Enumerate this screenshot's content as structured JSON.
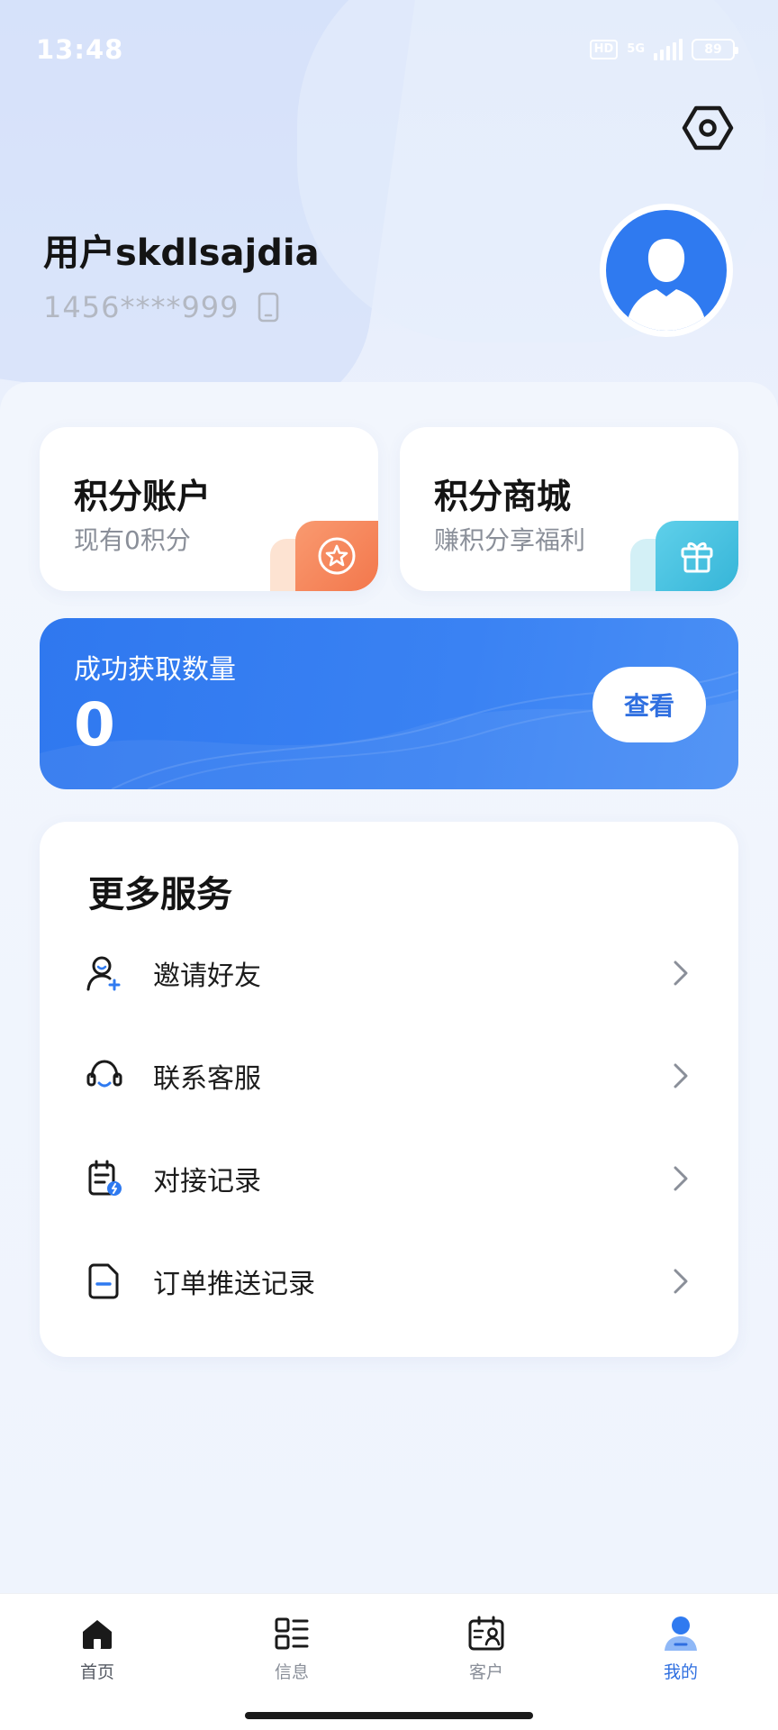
{
  "status_bar": {
    "time": "13:48",
    "hd_label": "HD",
    "network": "5G",
    "battery": "89"
  },
  "profile": {
    "username": "用户skdlsajdia",
    "phone": "1456****999",
    "phone_icon": "phone-icon",
    "avatar_icon": "user-avatar-icon",
    "settings_icon": "settings-hex-icon"
  },
  "cards": {
    "points_account": {
      "title": "积分账户",
      "subtitle": "现有0积分",
      "icon": "star-coin-icon",
      "accent": "#f5845a"
    },
    "points_mall": {
      "title": "积分商城",
      "subtitle": "赚积分享福利",
      "icon": "gift-icon",
      "accent": "#43c0e0"
    }
  },
  "stats": {
    "label": "成功获取数量",
    "value": "0",
    "view_button": "查看",
    "accent": "#3280f2"
  },
  "services": {
    "title": "更多服务",
    "items": [
      {
        "label": "邀请好友",
        "icon": "invite-friend-icon"
      },
      {
        "label": "联系客服",
        "icon": "customer-service-headset-icon"
      },
      {
        "label": "对接记录",
        "icon": "docking-record-icon"
      },
      {
        "label": "订单推送记录",
        "icon": "order-push-record-icon"
      }
    ]
  },
  "tabs": [
    {
      "label": "首页",
      "icon": "home-icon"
    },
    {
      "label": "信息",
      "icon": "info-grid-icon"
    },
    {
      "label": "客户",
      "icon": "customer-card-icon"
    },
    {
      "label": "我的",
      "icon": "profile-icon",
      "active": true
    }
  ],
  "colors": {
    "brand_blue": "#2f6fe0",
    "text_primary": "#141414",
    "text_secondary": "#8a8f99"
  }
}
